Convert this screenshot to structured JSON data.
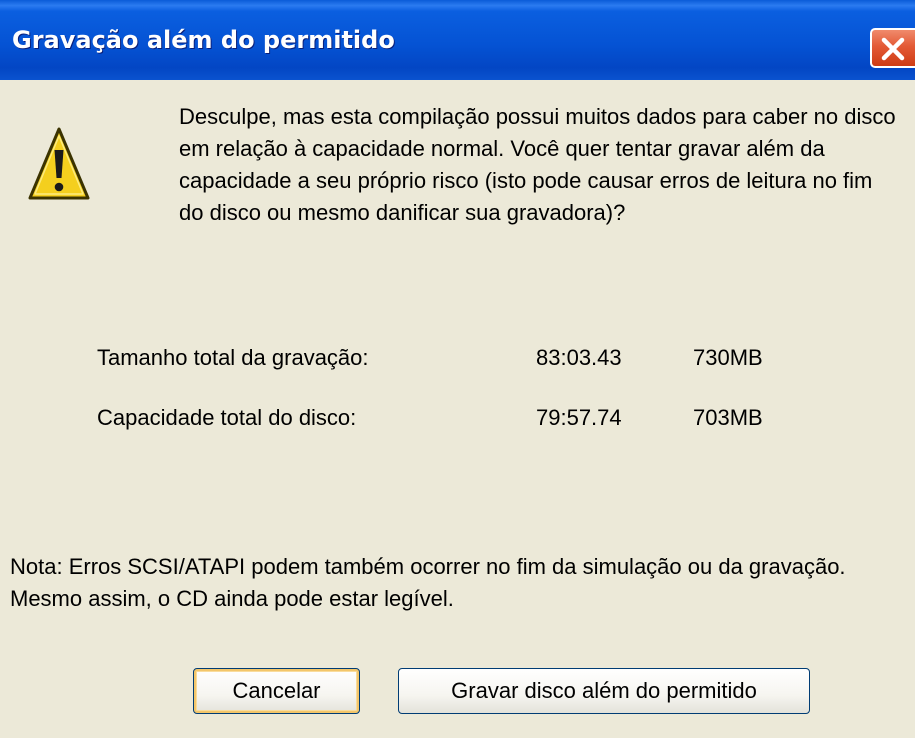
{
  "window": {
    "title": "Gravação além do permitido",
    "title_color": "#ffffff",
    "titlebar_color": "#0553d4",
    "background_color": "#ece9d8"
  },
  "icons": {
    "close": "close-icon",
    "warning": "warning-icon"
  },
  "message": "Desculpe, mas esta compilação possui muitos dados para caber no disco em relação à capacidade normal. Você quer tentar gravar além da capacidade a seu próprio risco (isto pode causar erros de leitura no fim do disco ou mesmo danificar sua gravadora)?",
  "details": {
    "rows": [
      {
        "label": "Tamanho total da gravação:",
        "time": "83:03.43",
        "size": "730MB"
      },
      {
        "label": "Capacidade total do disco:",
        "time": "79:57.74",
        "size": "703MB"
      }
    ]
  },
  "note": "Nota: Erros SCSI/ATAPI podem também ocorrer no fim da simulação ou da gravação. Mesmo assim, o CD ainda pode estar legível.",
  "buttons": {
    "cancel": "Cancelar",
    "burn": "Gravar disco além do permitido"
  }
}
